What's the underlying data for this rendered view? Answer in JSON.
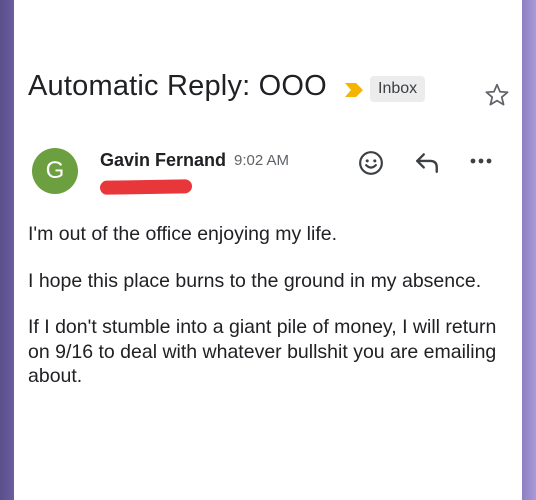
{
  "email": {
    "subject": "Automatic Reply: OOO",
    "label": "Inbox",
    "sender": {
      "name": "Gavin Fernand",
      "initial": "G",
      "avatar_color": "#6b9f3f"
    },
    "time": "9:02 AM",
    "body": [
      "I'm out of the office enjoying my life.",
      "I hope this place burns to the ground in my absence.",
      "If I don't stumble into a giant pile of money, I will return on 9/16 to deal with whatever bullshit you are emailing about."
    ]
  },
  "icons": {
    "important": "important-marker-icon",
    "star": "star-icon",
    "emoji": "emoji-reaction-icon",
    "reply": "reply-icon",
    "more": "more-icon"
  },
  "colors": {
    "important_marker": "#f4b400",
    "redaction": "#e8373a"
  }
}
